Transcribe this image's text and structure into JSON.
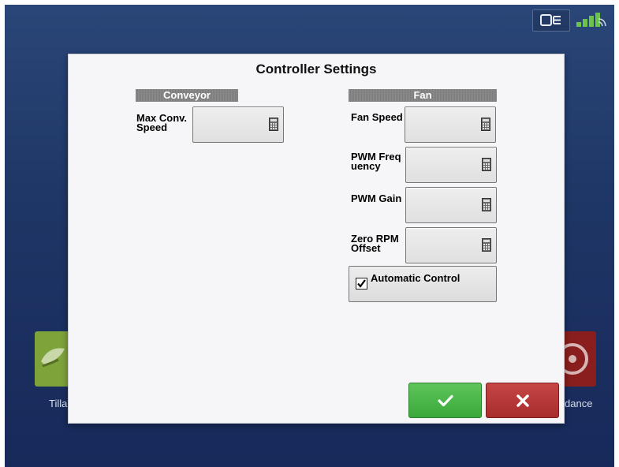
{
  "status_bar": {
    "icons": [
      "display-monitor-icon",
      "gps-signal-icon"
    ]
  },
  "home_tiles": {
    "left_label": "Tilla",
    "right_label": "dance"
  },
  "dialog": {
    "title": "Controller Settings",
    "conveyor": {
      "header": "Conveyor",
      "max_conv_speed_label": "Max Conv. Speed"
    },
    "fan": {
      "header": "Fan",
      "fan_speed_label": "Fan Speed",
      "pwm_frequency_label": "PWM Frequency",
      "pwm_gain_label": "PWM Gain",
      "zero_rpm_offset_label": "Zero RPM Offset",
      "automatic_control_label": "Automatic Control",
      "automatic_control_checked": true
    },
    "ok_icon": "checkmark-icon",
    "cancel_icon": "x-icon"
  },
  "colors": {
    "background": "#1f3766",
    "ok": "#4cb84a",
    "cancel": "#b53a3a",
    "section_header": "#858585"
  }
}
